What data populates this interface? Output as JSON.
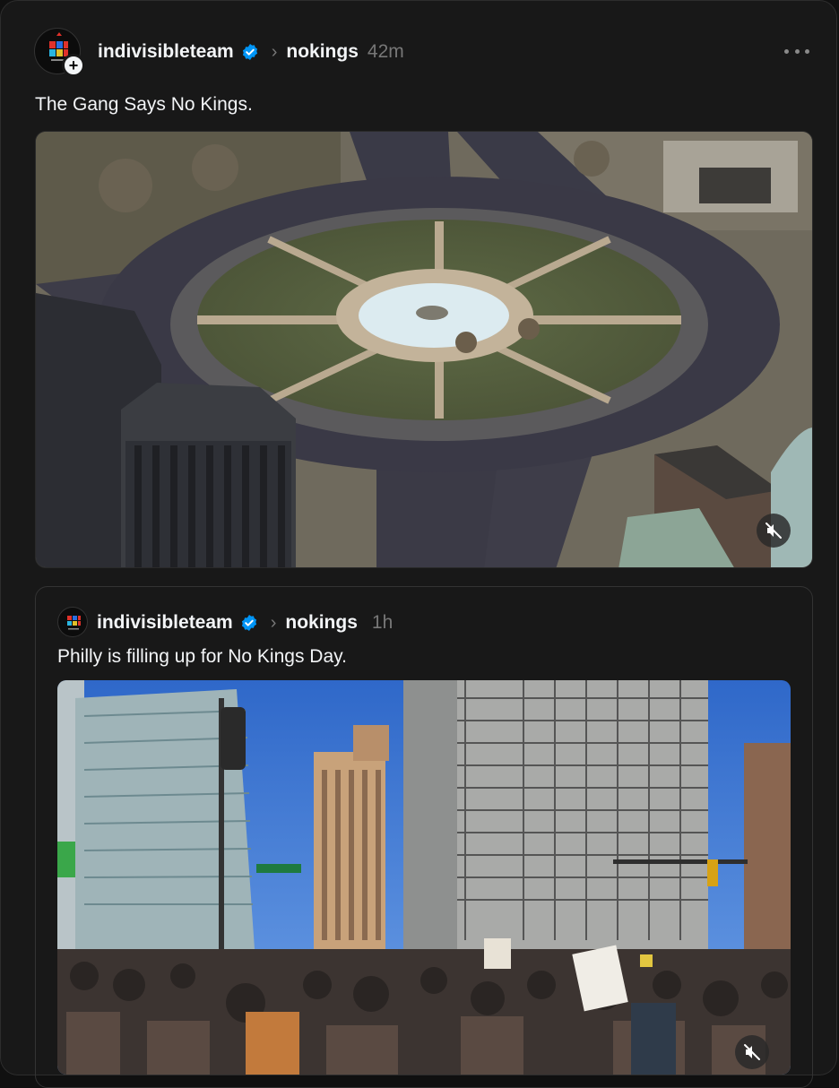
{
  "post": {
    "username": "indivisibleteam",
    "community": "nokings",
    "time": "42m",
    "caption": "The Gang Says No Kings.",
    "media": {
      "kind": "video",
      "muted": true,
      "icon": "speaker-muted-icon"
    }
  },
  "quoted_post": {
    "username": "indivisibleteam",
    "community": "nokings",
    "time": "1h",
    "caption": "Philly is filling up for No Kings Day.",
    "media": {
      "kind": "video",
      "muted": true,
      "icon": "speaker-muted-icon"
    }
  },
  "icons": {
    "verified": "verified-badge-icon",
    "chevron": "chevron-right-icon",
    "more": "more-dots-icon",
    "follow": "plus-icon"
  },
  "colors": {
    "background": "#181818",
    "text": "#f3f5f7",
    "muted_text": "#777777",
    "verified": "#0095f6"
  }
}
